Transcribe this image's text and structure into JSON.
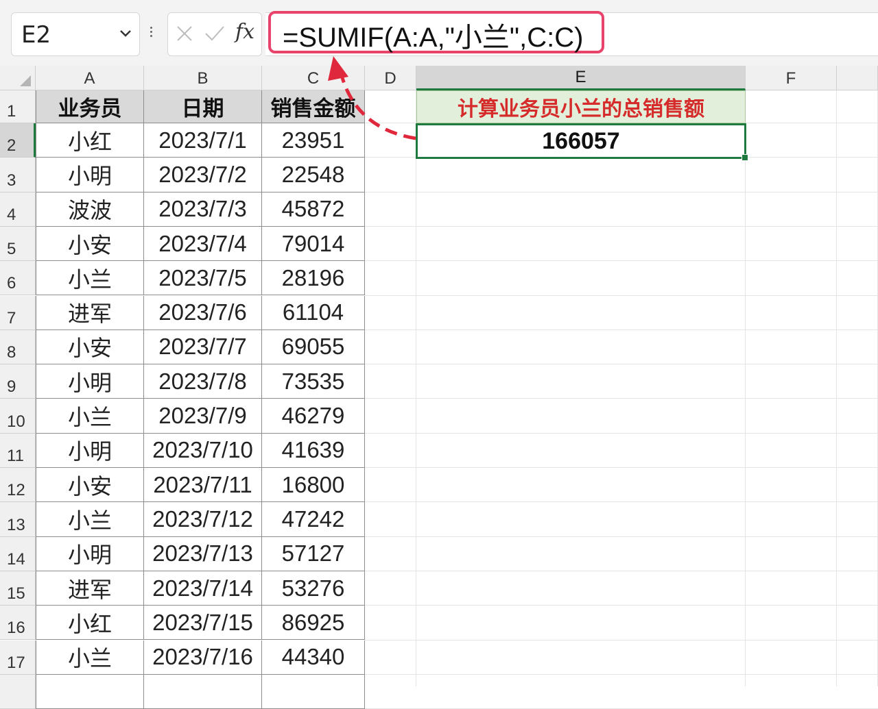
{
  "formula_bar": {
    "name_box": "E2",
    "formula": "=SUMIF(A:A,\"小兰\",C:C)",
    "fx_label": "fx"
  },
  "columns": [
    "A",
    "B",
    "C",
    "D",
    "E",
    "F"
  ],
  "selected_cell": "E2",
  "table": {
    "headers": [
      "业务员",
      "日期",
      "销售金额"
    ],
    "rows": [
      [
        "小红",
        "2023/7/1",
        "23951"
      ],
      [
        "小明",
        "2023/7/2",
        "22548"
      ],
      [
        "波波",
        "2023/7/3",
        "45872"
      ],
      [
        "小安",
        "2023/7/4",
        "79014"
      ],
      [
        "小兰",
        "2023/7/5",
        "28196"
      ],
      [
        "进军",
        "2023/7/6",
        "61104"
      ],
      [
        "小安",
        "2023/7/7",
        "69055"
      ],
      [
        "小明",
        "2023/7/8",
        "73535"
      ],
      [
        "小兰",
        "2023/7/9",
        "46279"
      ],
      [
        "小明",
        "2023/7/10",
        "41639"
      ],
      [
        "小安",
        "2023/7/11",
        "16800"
      ],
      [
        "小兰",
        "2023/7/12",
        "47242"
      ],
      [
        "小明",
        "2023/7/13",
        "57127"
      ],
      [
        "进军",
        "2023/7/14",
        "53276"
      ],
      [
        "小红",
        "2023/7/15",
        "86925"
      ],
      [
        "小兰",
        "2023/7/16",
        "44340"
      ]
    ]
  },
  "summary": {
    "label": "计算业务员小兰的总销售额",
    "value": "166057"
  },
  "colors": {
    "highlight": "#e8436a",
    "selection": "#1f7a3f",
    "summary_label": "#d62b2b",
    "summary_bg": "#e2efda",
    "arrow": "#e0283c"
  }
}
